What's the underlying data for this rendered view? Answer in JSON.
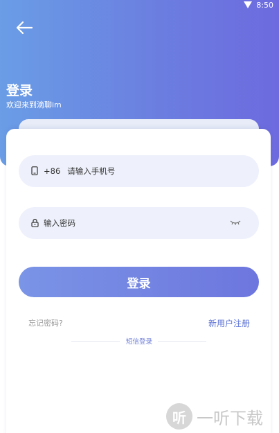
{
  "status_bar": {
    "time": "8:50"
  },
  "header": {
    "back_icon": "arrow-left-icon",
    "title": "登录",
    "subtitle": "欢迎来到滴聊im"
  },
  "form": {
    "phone": {
      "icon": "phone-icon",
      "prefix": "+86",
      "placeholder": "请输入手机号"
    },
    "password": {
      "icon": "lock-icon",
      "placeholder": "输入密码",
      "toggle_icon": "eye-closed-icon"
    },
    "login_button": "登录"
  },
  "links": {
    "forgot_password": "忘记密码?",
    "register": "新用户注册",
    "sms_login": "短信登录"
  },
  "watermark": {
    "logo_char": "听",
    "text": "一听下载"
  },
  "colors": {
    "gradient_start": "#6a9de6",
    "gradient_end": "#6d6adf",
    "field_bg": "#eef1fb",
    "accent": "#5d73d6"
  }
}
